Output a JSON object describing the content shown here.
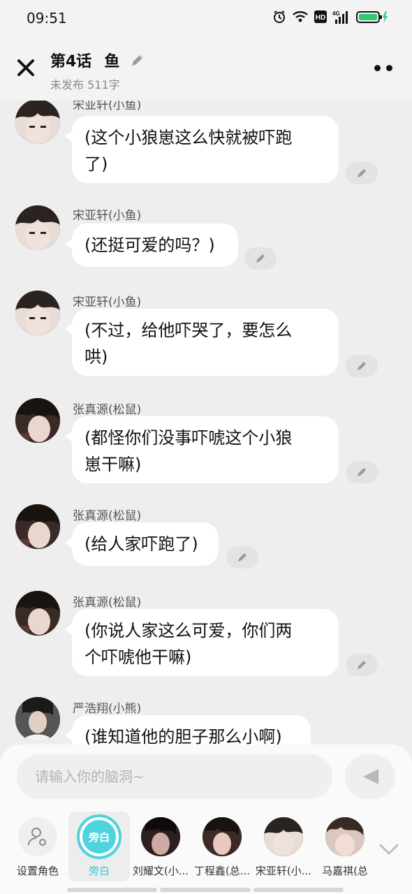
{
  "status": {
    "time": "09:51"
  },
  "header": {
    "episode": "第4话",
    "name": "鱼",
    "meta": "未发布 511字"
  },
  "messages": [
    {
      "sender": "宋亚轩(小鱼)",
      "text_lines": [
        "(这个小狼崽这么快就被吓跑",
        "了)"
      ]
    },
    {
      "sender": "宋亚轩(小鱼)",
      "text_lines": [
        "(还挺可爱的吗？)"
      ]
    },
    {
      "sender": "宋亚轩(小鱼)",
      "text_lines": [
        "(不过，给他吓哭了，要怎么",
        "哄)"
      ]
    },
    {
      "sender": "张真源(松鼠)",
      "text_lines": [
        "(都怪你们没事吓唬这个小狼",
        "崽干嘛)"
      ]
    },
    {
      "sender": "张真源(松鼠)",
      "text_lines": [
        "(给人家吓跑了)"
      ]
    },
    {
      "sender": "张真源(松鼠)",
      "text_lines": [
        "(你说人家这么可爱，你们两",
        "个吓唬他干嘛)"
      ]
    },
    {
      "sender": "严浩翔(小熊)",
      "text_lines": [
        "(谁知道他的胆子那么小啊)"
      ]
    }
  ],
  "composer": {
    "placeholder": "请输入你的脑洞~"
  },
  "roles": [
    {
      "label": "设置角色"
    },
    {
      "label": "旁白",
      "badge": "旁白"
    },
    {
      "label": "刘耀文(小..."
    },
    {
      "label": "丁程鑫(总..."
    },
    {
      "label": "宋亚轩(小..."
    },
    {
      "label": "马嘉祺(总"
    }
  ],
  "colors": {
    "accent": "#4fd3dc",
    "bubble": "#ffffff",
    "background": "#eeeeee"
  }
}
